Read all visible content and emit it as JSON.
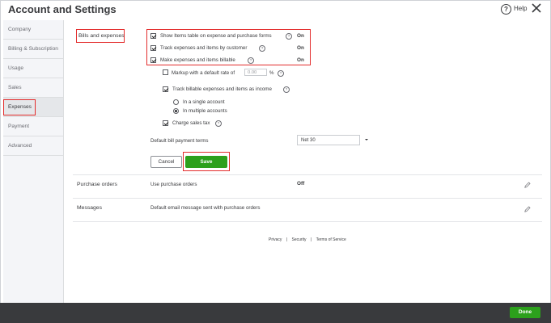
{
  "header": {
    "title": "Account and Settings",
    "help_label": "Help"
  },
  "sidebar": {
    "items": [
      {
        "label": "Company"
      },
      {
        "label": "Billing & Subscription"
      },
      {
        "label": "Usage"
      },
      {
        "label": "Sales"
      },
      {
        "label": "Expenses"
      },
      {
        "label": "Payment"
      },
      {
        "label": "Advanced"
      }
    ],
    "active": "Expenses"
  },
  "bills": {
    "section_label": "Bills and expenses",
    "options": [
      {
        "label": "Show Items table on expense and purchase forms",
        "status": "On",
        "checked": true
      },
      {
        "label": "Track expenses and items by customer",
        "status": "On",
        "checked": true
      },
      {
        "label": "Make expenses and items billable",
        "status": "On",
        "checked": true
      }
    ],
    "markup": {
      "label": "Markup with a default rate of",
      "placeholder": "0.00",
      "unit": "%",
      "checked": false
    },
    "track_income": {
      "label": "Track billable expenses and items as income",
      "checked": true
    },
    "radios": [
      {
        "label": "In a single account",
        "selected": false
      },
      {
        "label": "In multiple accounts",
        "selected": true
      }
    ],
    "sales_tax": {
      "label": "Charge sales tax",
      "checked": true
    },
    "payment_terms": {
      "label": "Default bill payment terms",
      "value": "Net 30"
    },
    "cancel_label": "Cancel",
    "save_label": "Save"
  },
  "purchase_orders": {
    "section_label": "Purchase orders",
    "option": "Use purchase orders",
    "status": "Off"
  },
  "messages": {
    "section_label": "Messages",
    "option": "Default email message sent with purchase orders"
  },
  "footer": {
    "privacy": "Privacy",
    "security": "Security",
    "terms": "Terms of Service",
    "sep": "|"
  },
  "done_label": "Done",
  "colors": {
    "accent_green": "#2ca01c",
    "highlight_red": "#e32c2c",
    "bottom_bar": "#393a3d"
  }
}
